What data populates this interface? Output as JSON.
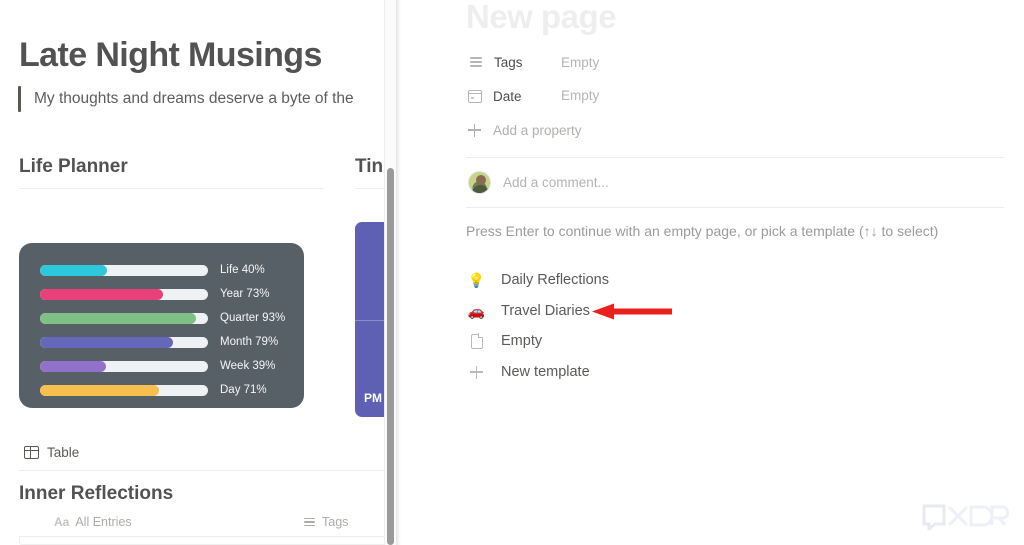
{
  "left_page": {
    "title": "Late Night Musings",
    "callout": "My thoughts and dreams deserve a byte of the",
    "columns": [
      {
        "heading": "Life Planner"
      },
      {
        "heading": "Tin"
      }
    ],
    "progress_card": {
      "rows": [
        {
          "label": "Life 40%",
          "name": "Life",
          "percent": 40,
          "color": "#00bcd4"
        },
        {
          "label": "Year 73%",
          "name": "Year",
          "percent": 73,
          "color": "#e5175c"
        },
        {
          "label": "Quarter 93%",
          "name": "Quarter",
          "percent": 93,
          "color": "#63b36a"
        },
        {
          "label": "Month 79%",
          "name": "Month",
          "percent": 79,
          "color": "#4246ab"
        },
        {
          "label": "Week 39%",
          "name": "Week",
          "percent": 39,
          "color": "#7a52c0"
        },
        {
          "label": "Day 71%",
          "name": "Day",
          "percent": 71,
          "color": "#f6b127"
        }
      ]
    },
    "timer_card": {
      "label": "PM"
    },
    "table_view": {
      "label": "Table",
      "icon": "table-icon"
    },
    "database": {
      "title": "Inner Reflections",
      "columns": [
        {
          "label": "All Entries",
          "icon": "text-aa-icon",
          "prefix": "Aa"
        },
        {
          "label": "Tags",
          "icon": "list-icon"
        }
      ]
    }
  },
  "new_page_panel": {
    "title": "New page",
    "properties": [
      {
        "name": "Tags",
        "value": "Empty",
        "icon": "list-icon"
      },
      {
        "name": "Date",
        "value": "Empty",
        "icon": "calendar-icon"
      }
    ],
    "add_property_label": "Add a property",
    "comment_placeholder": "Add a comment...",
    "hint": "Press Enter to continue with an empty page, or pick a template (↑↓ to select)",
    "templates": [
      {
        "label": "Daily Reflections",
        "icon": "lightbulb-icon",
        "glyph": "💡"
      },
      {
        "label": "Travel Diaries",
        "icon": "car-icon",
        "glyph": "🚗"
      },
      {
        "label": "Empty",
        "icon": "document-icon",
        "glyph": ""
      },
      {
        "label": "New template",
        "icon": "plus-icon",
        "glyph": ""
      }
    ]
  },
  "annotation": {
    "arrow_color": "#e8211c",
    "points_to": "Travel Diaries"
  },
  "watermark": {
    "text": "XDA"
  },
  "scrollbar": {
    "orientation": "vertical"
  }
}
